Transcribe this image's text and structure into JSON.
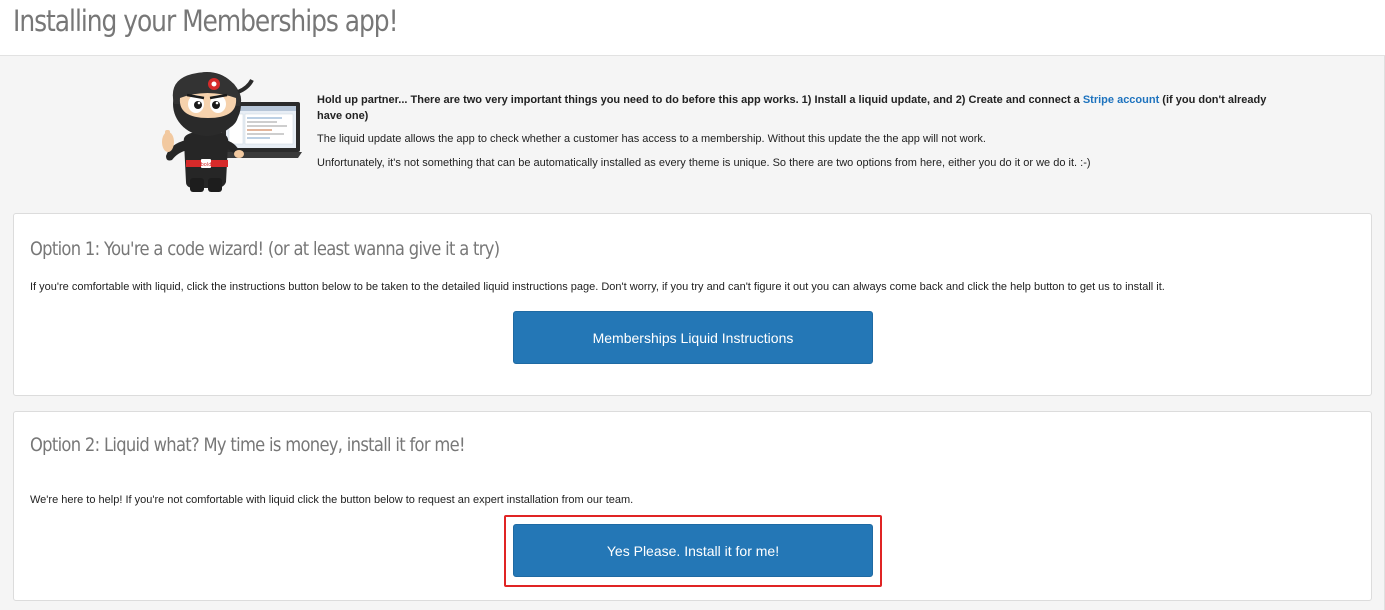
{
  "header": {
    "title": "Installing your Memberships app!"
  },
  "intro": {
    "mascot_icon": "ninja-mascot-with-laptop",
    "mascot_badge": "bold",
    "warning_before_link": "Hold up partner... There are two very important things you need to do before this app works. 1) Install a liquid update, and 2) Create and connect a ",
    "stripe_link": "Stripe account",
    "warning_after_link": " (if you don't already have one)",
    "paragraph_2": "The liquid update allows the app to check whether a customer has access to a membership. Without this update the the app will not work.",
    "paragraph_3": "Unfortunately, it's not something that can be automatically installed as every theme is unique. So there are two options from here, either you do it or we do it. :-)"
  },
  "option1": {
    "heading": "Option 1: You're a code wizard! (or at least wanna give it a try)",
    "description": "If you're comfortable with liquid, click the instructions button below to be taken to the detailed liquid instructions page. Don't worry, if you try and can't figure it out you can always come back and click the help button to get us to install it.",
    "button_label": "Memberships Liquid Instructions"
  },
  "option2": {
    "heading": "Option 2: Liquid what? My time is money, install it for me!",
    "description": "We're here to help! If you're not comfortable with liquid click the button below to request an expert installation from our team.",
    "button_label": "Yes Please. Install it for me!"
  },
  "colors": {
    "button": "#2477b6",
    "link": "#1e73be",
    "highlight": "#e02424",
    "heading": "#777777"
  }
}
